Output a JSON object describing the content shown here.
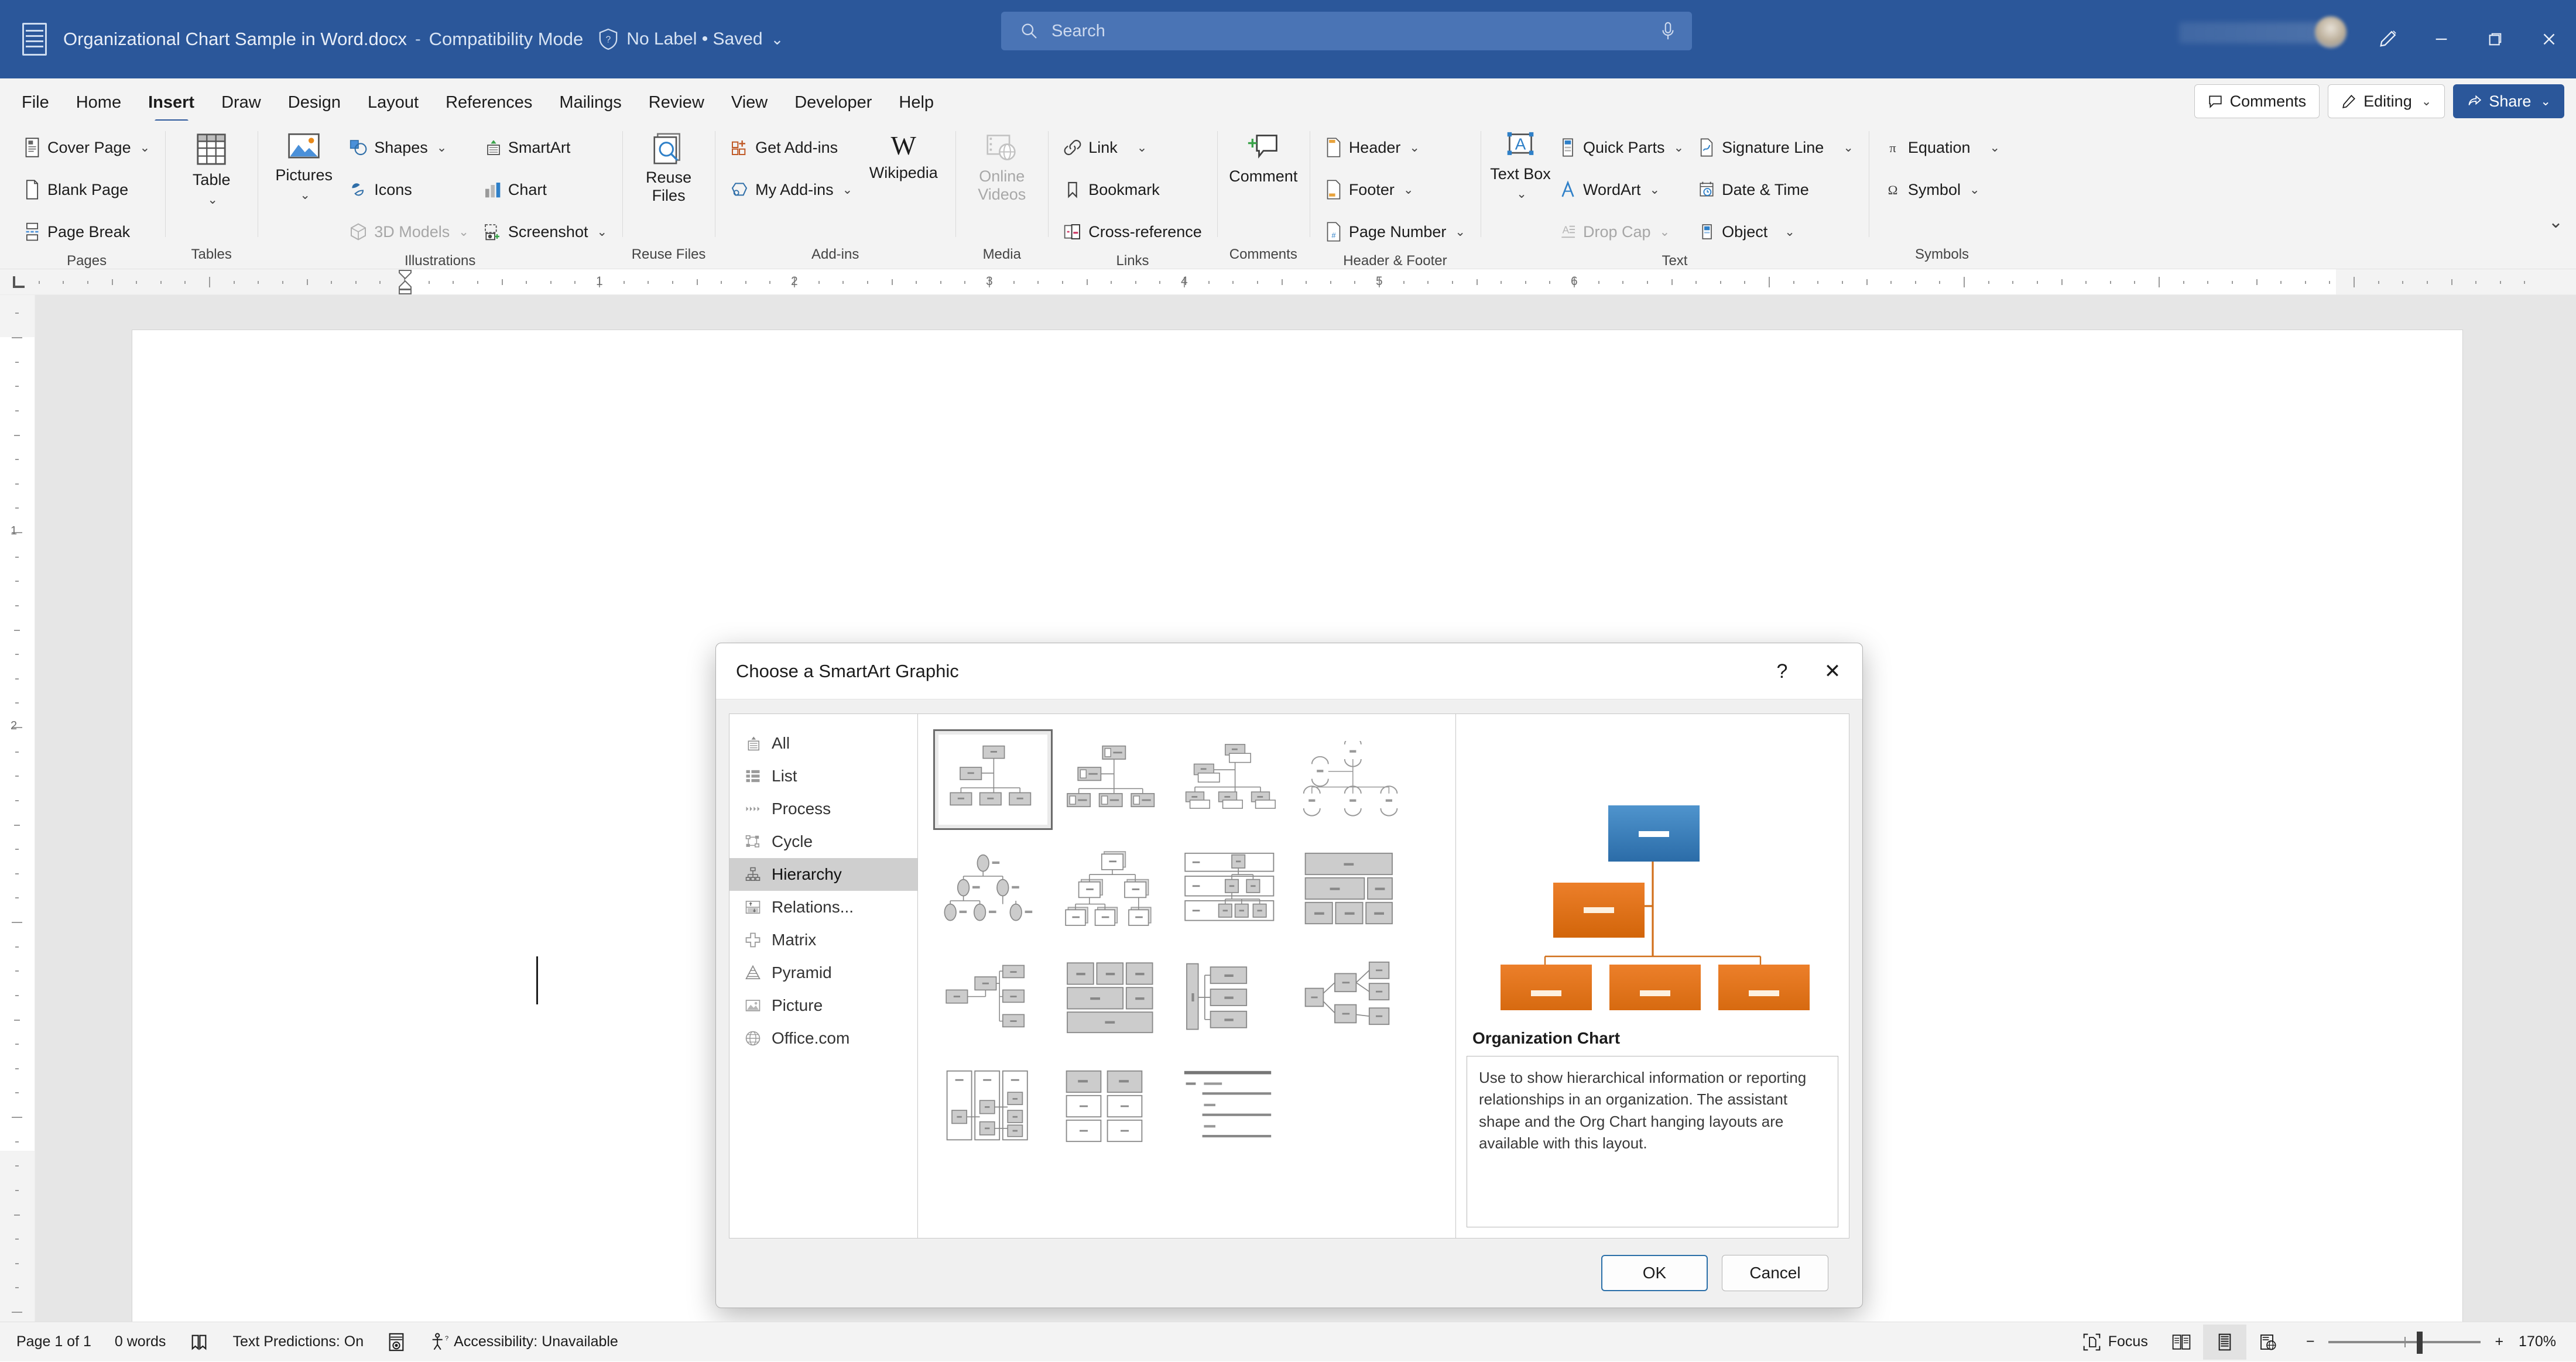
{
  "titlebar": {
    "app_icon": "word-logo-icon",
    "document_title": "Organizational Chart Sample in Word.docx",
    "separator": "-",
    "compatibility": "Compatibility Mode",
    "shield_icon": "shield-icon",
    "save_label": "No Label • Saved",
    "save_chevron": "⌄",
    "search": {
      "placeholder": "Search",
      "value": "",
      "icon": "search-icon",
      "mic_icon": "microphone-icon"
    },
    "pen_icon": "pen-highlighter-icon",
    "minimize": "minimize-icon",
    "restore": "restore-icon",
    "close": "close-icon"
  },
  "tabs": [
    {
      "label": "File",
      "active": false
    },
    {
      "label": "Home",
      "active": false
    },
    {
      "label": "Insert",
      "active": true
    },
    {
      "label": "Draw",
      "active": false
    },
    {
      "label": "Design",
      "active": false
    },
    {
      "label": "Layout",
      "active": false
    },
    {
      "label": "References",
      "active": false
    },
    {
      "label": "Mailings",
      "active": false
    },
    {
      "label": "Review",
      "active": false
    },
    {
      "label": "View",
      "active": false
    },
    {
      "label": "Developer",
      "active": false
    },
    {
      "label": "Help",
      "active": false
    }
  ],
  "tabbar_right": {
    "comments": "Comments",
    "editing": "Editing",
    "editing_chevron": "⌄",
    "share": "Share",
    "share_chevron": "⌄"
  },
  "ribbon": {
    "collapse_chevron": "⌄",
    "groups": [
      {
        "name": "Pages",
        "items": [
          {
            "label": "Cover Page",
            "icon": "cover-page-icon",
            "dropdown": true,
            "disabled": false
          },
          {
            "label": "Blank Page",
            "icon": "blank-page-icon",
            "dropdown": false,
            "disabled": false
          },
          {
            "label": "Page Break",
            "icon": "page-break-icon",
            "dropdown": false,
            "disabled": false
          }
        ]
      },
      {
        "name": "Tables",
        "items": [
          {
            "label": "Table",
            "icon": "table-icon",
            "dropdown": true,
            "disabled": false
          }
        ]
      },
      {
        "name": "Illustrations",
        "items": [
          {
            "label": "Pictures",
            "icon": "pictures-icon",
            "dropdown": true,
            "disabled": false
          },
          {
            "label": "Shapes",
            "icon": "shapes-icon",
            "dropdown": true,
            "disabled": false
          },
          {
            "label": "Icons",
            "icon": "icons-icon",
            "dropdown": false,
            "disabled": false
          },
          {
            "label": "3D Models",
            "icon": "3d-models-icon",
            "dropdown": true,
            "disabled": true
          },
          {
            "label": "SmartArt",
            "icon": "smartart-icon",
            "dropdown": false,
            "disabled": false
          },
          {
            "label": "Chart",
            "icon": "chart-icon",
            "dropdown": false,
            "disabled": false
          },
          {
            "label": "Screenshot",
            "icon": "screenshot-icon",
            "dropdown": true,
            "disabled": false
          }
        ]
      },
      {
        "name": "Reuse Files",
        "items": [
          {
            "label": "Reuse Files",
            "icon": "reuse-files-icon",
            "dropdown": false,
            "disabled": false
          }
        ]
      },
      {
        "name": "Add-ins",
        "items": [
          {
            "label": "Get Add-ins",
            "icon": "get-addins-icon",
            "dropdown": false,
            "disabled": false
          },
          {
            "label": "My Add-ins",
            "icon": "my-addins-icon",
            "dropdown": true,
            "disabled": false
          },
          {
            "label": "Wikipedia",
            "icon": "wikipedia-icon",
            "dropdown": false,
            "disabled": false
          }
        ]
      },
      {
        "name": "Media",
        "items": [
          {
            "label": "Online Videos",
            "icon": "online-videos-icon",
            "dropdown": false,
            "disabled": true
          }
        ]
      },
      {
        "name": "Links",
        "items": [
          {
            "label": "Link",
            "icon": "link-icon",
            "dropdown": true,
            "disabled": false
          },
          {
            "label": "Bookmark",
            "icon": "bookmark-icon",
            "dropdown": false,
            "disabled": false
          },
          {
            "label": "Cross-reference",
            "icon": "cross-reference-icon",
            "dropdown": false,
            "disabled": false
          }
        ]
      },
      {
        "name": "Comments",
        "items": [
          {
            "label": "Comment",
            "icon": "comment-icon",
            "dropdown": false,
            "disabled": false
          }
        ]
      },
      {
        "name": "Header & Footer",
        "items": [
          {
            "label": "Header",
            "icon": "header-icon",
            "dropdown": true,
            "disabled": false
          },
          {
            "label": "Footer",
            "icon": "footer-icon",
            "dropdown": true,
            "disabled": false
          },
          {
            "label": "Page Number",
            "icon": "page-number-icon",
            "dropdown": true,
            "disabled": false
          }
        ]
      },
      {
        "name": "Text",
        "items": [
          {
            "label": "Text Box",
            "icon": "text-box-icon",
            "dropdown": true,
            "disabled": false
          },
          {
            "label": "Quick Parts",
            "icon": "quick-parts-icon",
            "dropdown": true,
            "disabled": false
          },
          {
            "label": "WordArt",
            "icon": "wordart-icon",
            "dropdown": true,
            "disabled": false
          },
          {
            "label": "Drop Cap",
            "icon": "drop-cap-icon",
            "dropdown": true,
            "disabled": true
          },
          {
            "label": "Signature Line",
            "icon": "signature-line-icon",
            "dropdown": true,
            "disabled": false
          },
          {
            "label": "Date & Time",
            "icon": "date-time-icon",
            "dropdown": false,
            "disabled": false
          },
          {
            "label": "Object",
            "icon": "object-icon",
            "dropdown": true,
            "disabled": false
          }
        ]
      },
      {
        "name": "Symbols",
        "items": [
          {
            "label": "Equation",
            "icon": "equation-icon",
            "dropdown": true,
            "disabled": false
          },
          {
            "label": "Symbol",
            "icon": "symbol-icon",
            "dropdown": true,
            "disabled": false
          }
        ]
      }
    ]
  },
  "ruler": {
    "horizontal_numbers": [
      "1",
      "2",
      "3",
      "4",
      "5",
      "6"
    ],
    "vertical_numbers": [
      "1",
      "2"
    ],
    "tab_stop_icon": "left-tab-stop-icon",
    "indent_marker_icon": "indent-marker-icon"
  },
  "dialog": {
    "title": "Choose a SmartArt Graphic",
    "help_icon": "?",
    "close_icon": "✕",
    "categories": [
      {
        "label": "All",
        "icon": "all-icon",
        "selected": false
      },
      {
        "label": "List",
        "icon": "list-icon",
        "selected": false
      },
      {
        "label": "Process",
        "icon": "process-icon",
        "selected": false
      },
      {
        "label": "Cycle",
        "icon": "cycle-icon",
        "selected": false
      },
      {
        "label": "Hierarchy",
        "icon": "hierarchy-icon",
        "selected": true
      },
      {
        "label": "Relations...",
        "icon": "relationship-icon",
        "selected": false
      },
      {
        "label": "Matrix",
        "icon": "matrix-icon",
        "selected": false
      },
      {
        "label": "Pyramid",
        "icon": "pyramid-icon",
        "selected": false
      },
      {
        "label": "Picture",
        "icon": "picture-icon",
        "selected": false
      },
      {
        "label": "Office.com",
        "icon": "office-com-icon",
        "selected": false
      }
    ],
    "gallery": [
      {
        "id": "organization-chart",
        "selected": true
      },
      {
        "id": "name-and-title-organization-chart",
        "selected": false
      },
      {
        "id": "half-circle-organization-chart",
        "selected": false
      },
      {
        "id": "circle-picture-hierarchy",
        "selected": false
      },
      {
        "id": "hierarchy",
        "selected": false
      },
      {
        "id": "labeled-hierarchy",
        "selected": false
      },
      {
        "id": "table-hierarchy",
        "selected": false
      },
      {
        "id": "architecture-layout",
        "selected": false
      },
      {
        "id": "horizontal-organization-chart",
        "selected": false
      },
      {
        "id": "hierarchy-list",
        "selected": false
      },
      {
        "id": "horizontal-hierarchy",
        "selected": false
      },
      {
        "id": "horizontal-multi-level-hierarchy",
        "selected": false
      },
      {
        "id": "horizontal-labeled-hierarchy",
        "selected": false
      },
      {
        "id": "lined-list",
        "selected": false
      },
      {
        "id": "picture-organization-chart",
        "selected": false
      }
    ],
    "preview": {
      "name": "Organization Chart",
      "description": "Use to show hierarchical information or reporting relationships in an organization. The assistant shape and the Org Chart hanging layouts are available with this layout.",
      "colors": {
        "top_node": "#3d85c6",
        "child_node": "#e2700d",
        "connector": "#d1701c"
      }
    },
    "buttons": {
      "ok": "OK",
      "cancel": "Cancel"
    }
  },
  "statusbar": {
    "page": "Page 1 of 1",
    "words": "0 words",
    "proofing_icon": "proofing-errors-icon",
    "text_predictions": "Text Predictions: On",
    "dictate_icon": "record-icon",
    "accessibility": "Accessibility: Unavailable",
    "focus": "Focus",
    "focus_icon": "focus-icon",
    "view_read": "read-mode-icon",
    "view_print": "print-layout-icon",
    "view_web": "web-layout-icon",
    "zoom_out": "−",
    "zoom_in": "+",
    "zoom_level": "170%"
  }
}
